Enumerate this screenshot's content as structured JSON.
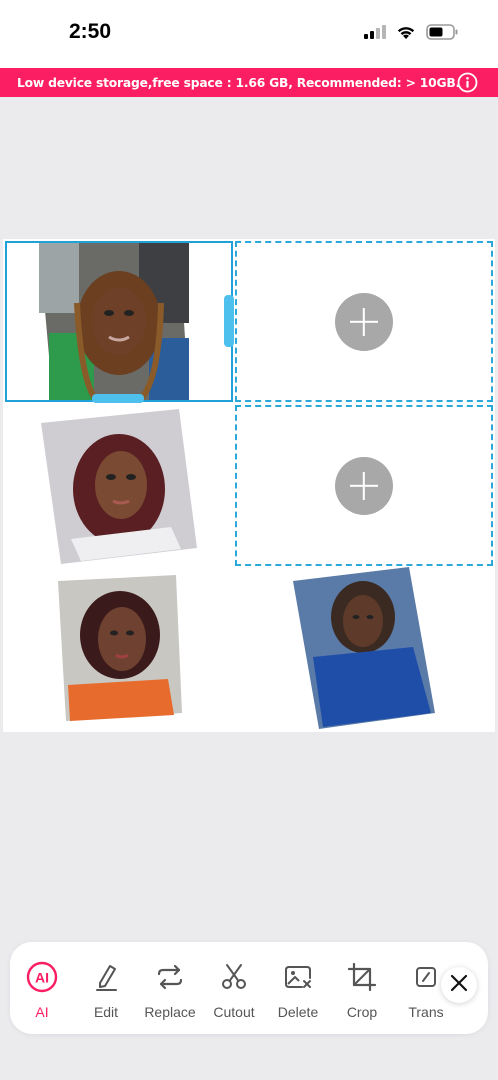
{
  "status_bar": {
    "time": "2:50",
    "icons": [
      "cellular-signal-icon",
      "wifi-icon",
      "battery-icon"
    ]
  },
  "banner": {
    "text": "Low device storage,free space : 1.66 GB,  Recommended: > 10GB.",
    "icon": "info-icon",
    "color": "#fb1e63"
  },
  "collage": {
    "photos": [
      {
        "name": "photo-1-selected",
        "icon": "portrait-photo"
      },
      {
        "name": "photo-2",
        "icon": "portrait-photo"
      },
      {
        "name": "photo-3",
        "icon": "portrait-photo"
      },
      {
        "name": "photo-4",
        "icon": "portrait-photo"
      }
    ],
    "empty_slots": [
      {
        "name": "add-photo-slot-1",
        "icon": "plus-icon"
      },
      {
        "name": "add-photo-slot-2",
        "icon": "plus-icon"
      }
    ],
    "accent_color": "#2aa8d9"
  },
  "toolbar": {
    "tools": [
      {
        "label": "AI",
        "icon": "ai-icon",
        "active": true
      },
      {
        "label": "Edit",
        "icon": "pen-icon",
        "active": false
      },
      {
        "label": "Replace",
        "icon": "replace-icon",
        "active": false
      },
      {
        "label": "Cutout",
        "icon": "scissors-icon",
        "active": false
      },
      {
        "label": "Delete",
        "icon": "delete-image-icon",
        "active": false
      },
      {
        "label": "Crop",
        "icon": "crop-icon",
        "active": false
      },
      {
        "label": "Trans",
        "icon": "transform-icon",
        "active": false
      }
    ],
    "close_icon": "close-icon",
    "active_color": "#fb1e63"
  }
}
